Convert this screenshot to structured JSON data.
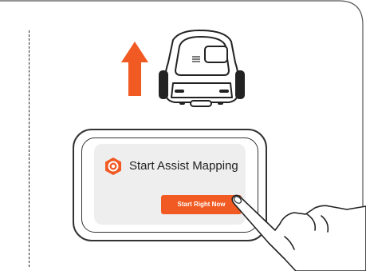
{
  "dialog": {
    "title": "Start Assist Mapping",
    "start_button_label": "Start Right Now"
  },
  "illustration": {
    "arrow_direction": "up",
    "robot": "lawn-mower-robot",
    "hand": "tapping-hand",
    "app_icon": "mapping-hexagon-icon"
  },
  "colors": {
    "accent": "#f15a22",
    "arrow": "#f15a22",
    "screen_background": "#eeeeee",
    "outline": "#333333"
  }
}
